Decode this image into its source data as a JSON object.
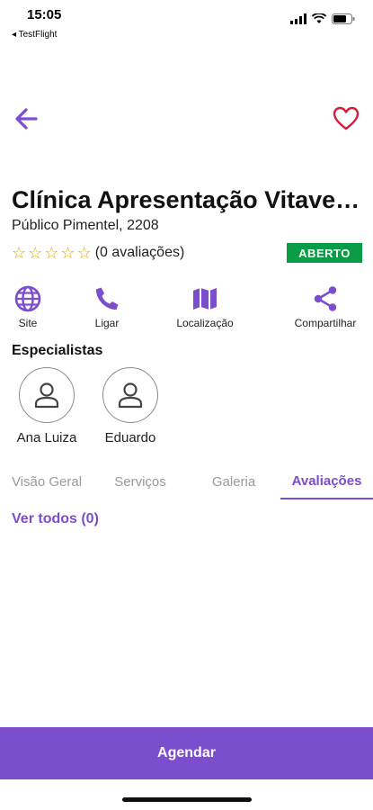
{
  "status_bar": {
    "time": "15:05",
    "back_app": "◂ TestFlight",
    "icons": [
      "cellular-icon",
      "wifi-icon",
      "battery-icon"
    ]
  },
  "nav": {
    "back_icon": "arrow-left-icon",
    "favorite_icon": "heart-outline-icon"
  },
  "clinic": {
    "name": "Clínica Apresentação Vitave…",
    "address": "Público Pimentel, 2208",
    "stars": [
      "☆",
      "☆",
      "☆",
      "☆",
      "☆"
    ],
    "rating_text": "(0 avaliações)",
    "status": "ABERTO"
  },
  "actions": [
    {
      "label": "Site",
      "icon": "globe-icon"
    },
    {
      "label": "Ligar",
      "icon": "phone-icon"
    },
    {
      "label": "Localização",
      "icon": "map-icon"
    },
    {
      "label": "Compartilhar",
      "icon": "share-icon"
    }
  ],
  "specialists": {
    "title": "Especialistas",
    "items": [
      {
        "name": "Ana Luiza",
        "icon": "user-icon"
      },
      {
        "name": "Eduardo",
        "icon": "user-icon"
      }
    ]
  },
  "tabs": [
    {
      "label": "Visão Geral",
      "active": false
    },
    {
      "label": "Serviços",
      "active": false
    },
    {
      "label": "Galeria",
      "active": false
    },
    {
      "label": "Avaliações",
      "active": true
    }
  ],
  "reviews": {
    "view_all": "Ver todos (0)"
  },
  "footer": {
    "schedule_label": "Agendar"
  },
  "colors": {
    "accent": "#7c4dcc",
    "favorite": "#d81b3b",
    "status_open": "#0a9b47",
    "star": "#e0a800"
  }
}
